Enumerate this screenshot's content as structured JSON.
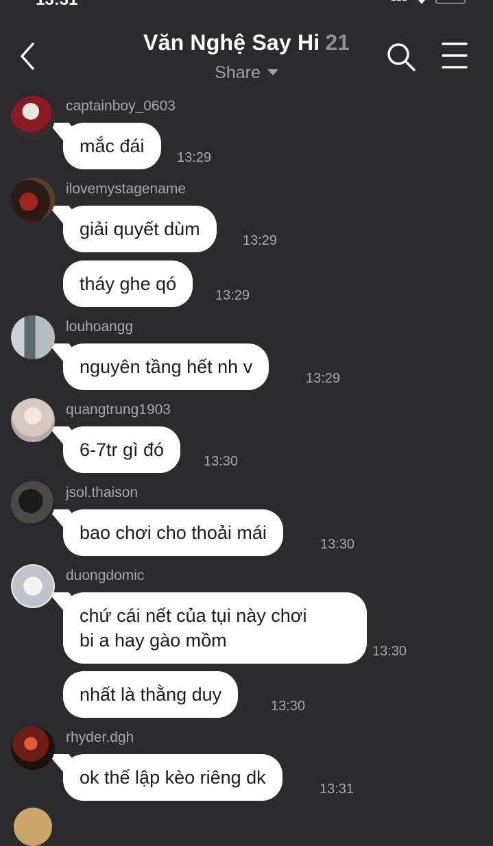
{
  "status_bar": {
    "time": "13:31"
  },
  "header": {
    "title": "Văn Nghệ Say Hi",
    "member_count": "21",
    "subtitle": "Share"
  },
  "messages": [
    {
      "user": "captainboy_0603",
      "text": "mắc đái",
      "time": "13:29"
    },
    {
      "user": "ilovemystagename",
      "text": "giải quyết dùm",
      "time": "13:29"
    },
    {
      "user": "",
      "text": "tháy ghe qó",
      "time": "13:29"
    },
    {
      "user": "louhoangg",
      "text": "nguyên tầng hết nh v",
      "time": "13:29"
    },
    {
      "user": "quangtrung1903",
      "text": "6-7tr gì đó",
      "time": "13:30"
    },
    {
      "user": "jsol.thaison",
      "text": "bao chơi cho thoải mái",
      "time": "13:30"
    },
    {
      "user": "duongdomic",
      "text_line1": "chứ cái nết của tụi này chơi",
      "text_line2": "bi a hay gào mồm",
      "time": "13:30"
    },
    {
      "user": "",
      "text": "nhất là thằng duy",
      "time": "13:30"
    },
    {
      "user": "rhyder.dgh",
      "text": "ok thế lập kèo riêng dk",
      "time": "13:31"
    }
  ],
  "colors": {
    "background": "#2b2b2d",
    "bubble": "#ffffff",
    "bubble_text": "#1c1c1e",
    "meta_text": "#a8a8ad"
  },
  "icons": [
    "back-chevron-icon",
    "search-icon",
    "menu-icon",
    "caret-down-icon"
  ]
}
